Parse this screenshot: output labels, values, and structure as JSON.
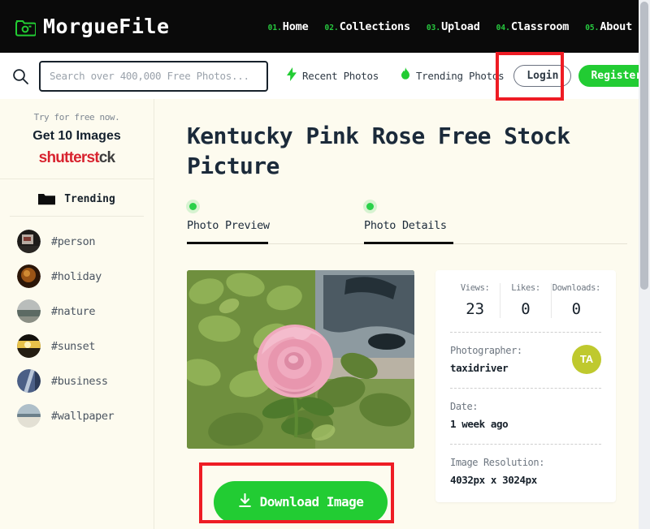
{
  "header": {
    "brand": {
      "name": "MorgueFile",
      "icon": "folder-camera-icon"
    },
    "nav": [
      {
        "num": "01.",
        "label": "Home"
      },
      {
        "num": "02.",
        "label": "Collections"
      },
      {
        "num": "03.",
        "label": "Upload"
      },
      {
        "num": "04.",
        "label": "Classroom"
      },
      {
        "num": "05.",
        "label": "About"
      }
    ]
  },
  "search": {
    "icon": "search-icon",
    "placeholder": "Search over 400,000 Free Photos...",
    "value": "",
    "recent": {
      "icon": "lightning-icon",
      "label": "Recent Photos"
    },
    "trending": {
      "icon": "flame-icon",
      "label": "Trending Photos"
    },
    "login_label": "Login",
    "register_label": "Register"
  },
  "sidebar": {
    "ad": {
      "subtitle": "Try for free now.",
      "headline": "Get 10 Images",
      "brand_red": "shutterst",
      "brand_dark": "ck"
    },
    "trending": {
      "icon": "folder-icon",
      "label": "Trending",
      "tags": [
        {
          "label": "#person"
        },
        {
          "label": "#holiday"
        },
        {
          "label": "#nature"
        },
        {
          "label": "#sunset"
        },
        {
          "label": "#business"
        },
        {
          "label": "#wallpaper"
        }
      ]
    }
  },
  "main": {
    "title": "Kentucky Pink Rose Free Stock Picture",
    "tabs": [
      {
        "label": "Photo Preview",
        "active": true
      },
      {
        "label": "Photo Details",
        "active": true
      }
    ],
    "photo_alt": "pink rose in garden with car in background",
    "download_label": "Download Image",
    "download_icon": "download-icon",
    "details": {
      "stats": [
        {
          "key": "Views:",
          "value": "23"
        },
        {
          "key": "Likes:",
          "value": "0"
        },
        {
          "key": "Downloads:",
          "value": "0"
        }
      ],
      "photographer_key": "Photographer:",
      "photographer_value": "taxidriver",
      "photographer_initials": "TA",
      "date_key": "Date:",
      "date_value": "1 week ago",
      "resolution_key": "Image Resolution:",
      "resolution_value": "4032px x 3024px"
    }
  },
  "annotations": [
    {
      "name": "login-highlight",
      "color": "#ee1c24"
    },
    {
      "name": "download-highlight",
      "color": "#ee1c24"
    }
  ],
  "colors": {
    "accent_green": "#22cc33",
    "topbar": "#0a0a0a",
    "page_bg": "#fdfbef",
    "title": "#1b2a3a",
    "annotation": "#ee1c24"
  }
}
